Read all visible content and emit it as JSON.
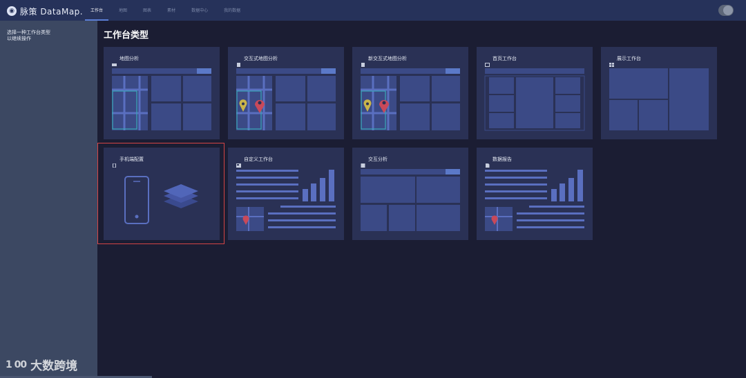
{
  "header": {
    "brand": "脉策 DataMap.",
    "logo_icon": "map-pin-logo-icon",
    "tabs": [
      {
        "label": "工作台",
        "active": true
      },
      {
        "label": "地图",
        "active": false
      },
      {
        "label": "图表",
        "active": false
      },
      {
        "label": "素材",
        "active": false
      },
      {
        "label": "数据中心",
        "active": false
      },
      {
        "label": "我的数据",
        "active": false
      }
    ],
    "toggle_icon": "theme-toggle-icon"
  },
  "sidebar": {
    "hint_line1": "选择一种工作台类型",
    "hint_line2": "以继续操作"
  },
  "main": {
    "title": "工作台类型",
    "cards": [
      {
        "title": "地图分析",
        "icon": "map-icon"
      },
      {
        "title": "交互式地图分析",
        "icon": "document-icon"
      },
      {
        "title": "新交互式地图分析",
        "icon": "document-icon"
      },
      {
        "title": "首页工作台",
        "icon": "window-icon"
      },
      {
        "title": "展示工作台",
        "icon": "grid-icon"
      },
      {
        "title": "手机端配置",
        "icon": "mobile-icon",
        "selected": true
      },
      {
        "title": "自定义工作台",
        "icon": "image-icon"
      },
      {
        "title": "交互分析",
        "icon": "square-icon"
      },
      {
        "title": "数据报告",
        "icon": "file-icon"
      }
    ]
  },
  "watermark": {
    "logo": "1 00",
    "text": "大数跨境"
  },
  "colors": {
    "topbar": "#26325a",
    "background": "#1b1d33",
    "sidebar": "#3c4862",
    "card": "#2a3155",
    "accent": "#5b7fd6",
    "selection": "#d64545",
    "marker_red": "#c8495a",
    "marker_yellow": "#c9b44a",
    "teal": "#3aa8b8"
  }
}
